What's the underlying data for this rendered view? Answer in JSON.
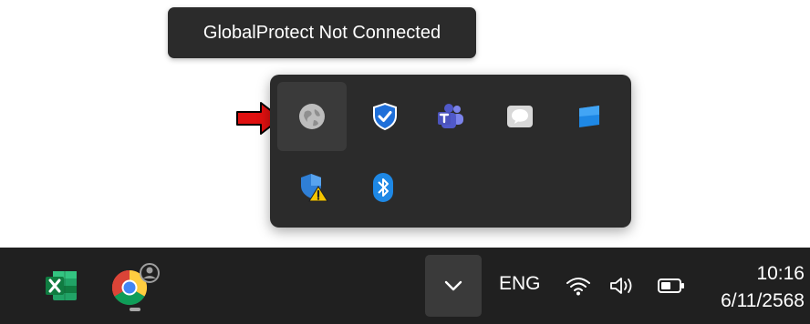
{
  "tooltip": {
    "text": "GlobalProtect Not Connected"
  },
  "tray_flyout": {
    "icons": [
      {
        "name": "globalprotect-icon",
        "hovered": true
      },
      {
        "name": "windows-security-icon"
      },
      {
        "name": "teams-icon"
      },
      {
        "name": "chat-app-icon"
      },
      {
        "name": "blue-tile-app-icon"
      },
      {
        "name": "defender-warning-icon"
      },
      {
        "name": "bluetooth-icon"
      }
    ]
  },
  "taskbar": {
    "apps": [
      {
        "name": "excel-icon"
      },
      {
        "name": "chrome-icon",
        "running": true
      }
    ],
    "overflow_icon": "chevron-down-icon",
    "language": "ENG",
    "system_icons": [
      "wifi-icon",
      "speaker-icon",
      "battery-icon"
    ],
    "clock": {
      "time": "10:16",
      "date": "6/11/2568"
    }
  },
  "colors": {
    "flyout_bg": "#2b2b2b",
    "taskbar_bg": "#202020",
    "accent_blue": "#2f80ed",
    "pointer_red": "#e01010"
  }
}
